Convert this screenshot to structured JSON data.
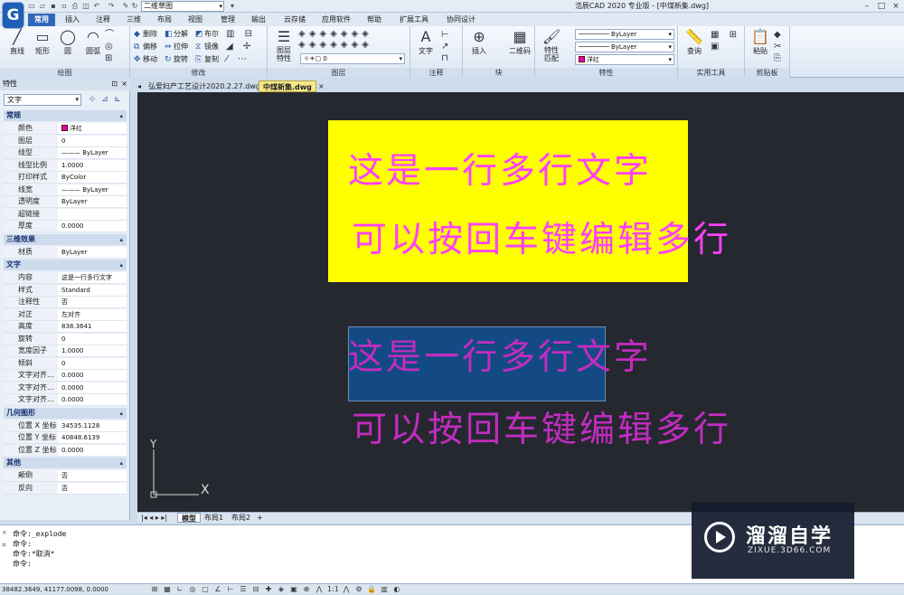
{
  "titlebar": {
    "workspace": "二维草图",
    "app_title": "浩辰CAD 2020 专业版 - [中煤新集.dwg]",
    "logo_letter": "G"
  },
  "ribbon_tabs": [
    "常用",
    "插入",
    "注释",
    "三维",
    "布局",
    "视图",
    "管理",
    "输出",
    "云存储",
    "应用软件",
    "帮助",
    "扩展工具",
    "协同设计"
  ],
  "ribbon": {
    "draw": {
      "label": "绘图",
      "line": "直线",
      "rect": "矩形",
      "circle": "圆",
      "arc": "圆弧"
    },
    "modify": {
      "label": "修改",
      "delete": "删除",
      "explode": "分解",
      "boolean": "布尔",
      "offset": "偏移",
      "stretch": "拉伸",
      "mirror": "镜像",
      "move": "移动",
      "rotate": "旋转",
      "copy": "复制"
    },
    "layer": {
      "label": "图层",
      "layer_props": "图层\n特性",
      "current_layer": "0"
    },
    "annotation": {
      "label": "注释",
      "text": "文字"
    },
    "block": {
      "label": "块",
      "insert": "插入",
      "qrcode": "二维码"
    },
    "properties": {
      "label": "特性",
      "match": "特性\n匹配",
      "linetype": "ByLayer",
      "lineweight": "ByLayer",
      "color": "洋红"
    },
    "utilities": {
      "label": "实用工具",
      "query": "查询"
    },
    "clipboard": {
      "label": "剪贴板",
      "paste": "粘贴"
    }
  },
  "panel": {
    "title": "特性",
    "object_type": "文字",
    "sections": {
      "general": {
        "title": "常规",
        "rows": [
          {
            "k": "颜色",
            "v": "洋红"
          },
          {
            "k": "图层",
            "v": "0"
          },
          {
            "k": "线型",
            "v": "——— ByLayer"
          },
          {
            "k": "线型比例",
            "v": "1.0000"
          },
          {
            "k": "打印样式",
            "v": "ByColor"
          },
          {
            "k": "线宽",
            "v": "——— ByLayer"
          },
          {
            "k": "透明度",
            "v": "ByLayer"
          },
          {
            "k": "超链接",
            "v": ""
          },
          {
            "k": "厚度",
            "v": "0.0000"
          }
        ]
      },
      "3d": {
        "title": "三维效果",
        "rows": [
          {
            "k": "材质",
            "v": "ByLayer"
          }
        ]
      },
      "text": {
        "title": "文字",
        "rows": [
          {
            "k": "内容",
            "v": "这是一行多行文字"
          },
          {
            "k": "样式",
            "v": "Standard"
          },
          {
            "k": "注释性",
            "v": "否"
          },
          {
            "k": "对正",
            "v": "左对齐"
          },
          {
            "k": "高度",
            "v": "838.3641"
          },
          {
            "k": "旋转",
            "v": "0"
          },
          {
            "k": "宽度因子",
            "v": "1.0000"
          },
          {
            "k": "倾斜",
            "v": "0"
          },
          {
            "k": "文字对齐...",
            "v": "0.0000"
          },
          {
            "k": "文字对齐...",
            "v": "0.0000"
          },
          {
            "k": "文字对齐...",
            "v": "0.0000"
          }
        ]
      },
      "geometry": {
        "title": "几何图形",
        "rows": [
          {
            "k": "位置 X 坐标",
            "v": "34535.1128"
          },
          {
            "k": "位置 Y 坐标",
            "v": "40848.6139"
          },
          {
            "k": "位置 Z 坐标",
            "v": "0.0000"
          }
        ]
      },
      "misc": {
        "title": "其他",
        "rows": [
          {
            "k": "颠倒",
            "v": "否"
          },
          {
            "k": "反向",
            "v": "否"
          }
        ]
      }
    }
  },
  "doc_tabs": [
    "弘爱妇产工艺设计2020.2.27.dwg",
    "中煤新集.dwg"
  ],
  "canvas": {
    "line1": "这是一行多行文字",
    "line2": "可以按回车键编辑多行",
    "ucs_x": "X",
    "ucs_y": "Y"
  },
  "layout_tabs": [
    "模型",
    "布局1",
    "布局2",
    "+"
  ],
  "command": {
    "lines": [
      "命令:_explode",
      "命令:",
      "命令:*取消*",
      "命令:"
    ]
  },
  "status": {
    "coords": "38482.3649, 41177.0098, 0.0000"
  },
  "watermark": {
    "cn": "溜溜自学",
    "en": "ZIXUE.3D66.COM"
  }
}
